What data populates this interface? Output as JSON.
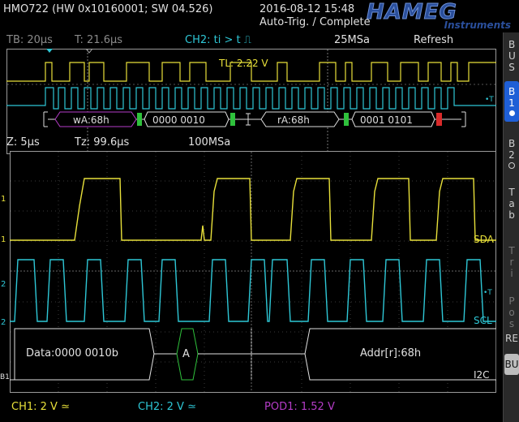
{
  "header": {
    "model_info": "HMO722 (HW 0x10160001; SW 04.526)",
    "datetime": "2016-08-12 15:48",
    "status": "Auto-Trig. / Complete",
    "logo_text": "HAMEG",
    "logo_sub": "Instruments"
  },
  "top_info": {
    "timebase": "TB: 20µs",
    "trigger_time": "T: 21.6µs",
    "trigger_setting": "CH2: ti > t ⎍",
    "sample_rate": "25MSa",
    "mode": "Refresh"
  },
  "overview": {
    "trigger_level": "TL: 2.22 V",
    "decode": [
      "wA:68h",
      "0000 0010",
      "rA:68h",
      "0001 0101"
    ]
  },
  "zoom_info": {
    "zoom": "Z: 5µs",
    "zoom_time": "Tz: 99.6µs",
    "sample_rate": "100MSa"
  },
  "main": {
    "ch1_label": "SDA",
    "ch2_label": "SCL",
    "bus_label": "I2C",
    "data_frame": "Data:0000 0010b",
    "ack_frame": "A",
    "addr_frame": "Addr[r]:68h",
    "marker_ch1": "1",
    "marker_ch2": "2",
    "marker_bus": "B1"
  },
  "sidebar": {
    "bus": "B U S",
    "b1": "B 1",
    "b2": "B 2",
    "table": "T a b",
    "trig": "T r i",
    "pos": "P o s",
    "re": "RE",
    "bu": "BU"
  },
  "footer": {
    "ch1": "CH1: 2 V ≃",
    "ch2": "CH2: 2 V ≃",
    "pod": "POD1: 1.52 V"
  },
  "colors": {
    "ch1": "#e8e03a",
    "ch2": "#2ec7d6",
    "pod": "#b53cc7",
    "ack": "#2fc13c",
    "stop": "#d92a2a",
    "bus_frame": "#e0e0e0"
  }
}
